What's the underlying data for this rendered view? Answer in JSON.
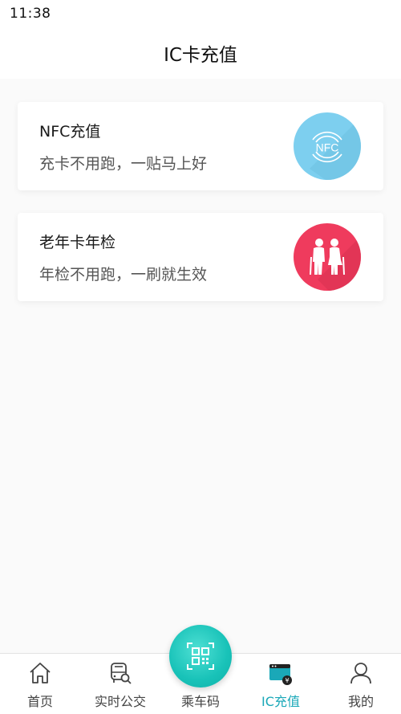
{
  "status_bar": {
    "time": "11:38"
  },
  "header": {
    "title": "IC卡充值"
  },
  "cards": [
    {
      "title": "NFC充值",
      "subtitle": "充卡不用跑，一贴马上好",
      "icon": "nfc-icon",
      "icon_text": "NFC",
      "icon_color": "#7dcfef"
    },
    {
      "title": "老年卡年检",
      "subtitle": "年检不用跑，一刷就生效",
      "icon": "elderly-couple-icon",
      "icon_color": "#ef3b5d"
    }
  ],
  "tab_bar": {
    "tabs": [
      {
        "label": "首页",
        "icon": "home-icon",
        "active": false
      },
      {
        "label": "实时公交",
        "icon": "bus-search-icon",
        "active": false
      },
      {
        "label": "乘车码",
        "icon": "qr-code-icon",
        "active": false
      },
      {
        "label": "IC充值",
        "icon": "card-wallet-icon",
        "active": true
      },
      {
        "label": "我的",
        "icon": "user-icon",
        "active": false
      }
    ],
    "accent_color": "#1aa8b8"
  }
}
